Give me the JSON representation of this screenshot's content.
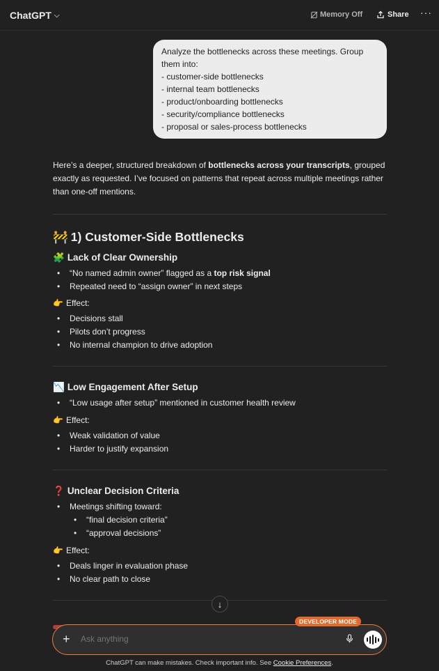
{
  "header": {
    "model_label": "ChatGPT",
    "memory_label": "Memory Off",
    "share_label": "Share",
    "more_label": "···"
  },
  "user_message": {
    "lines": [
      "Analyze the bottlenecks across these meetings. Group",
      "them into:",
      "- customer-side bottlenecks",
      "- internal team bottlenecks",
      "- product/onboarding bottlenecks",
      "- security/compliance bottlenecks",
      "- proposal or sales-process bottlenecks"
    ]
  },
  "assistant": {
    "intro_pre": "Here’s a deeper, structured breakdown of ",
    "intro_bold": "bottlenecks across your transcripts",
    "intro_post": ", grouped exactly as requested. I’ve focused on patterns that repeat across multiple meetings rather than one-off mentions.",
    "section1_icon": "🚧",
    "section1_title": "1) Customer-Side Bottlenecks",
    "effect_icon": "👉",
    "effect_label": "Effect:",
    "sub1": {
      "icon": "🧩",
      "title": "Lack of Clear Ownership",
      "bullet1_pre": "“No named admin owner” flagged as a ",
      "bullet1_bold": "top risk signal",
      "bullet2": "Repeated need to “assign owner” in next steps",
      "effects": [
        "Decisions stall",
        "Pilots don’t progress",
        "No internal champion to drive adoption"
      ]
    },
    "sub2": {
      "icon": "📉",
      "title": "Low Engagement After Setup",
      "bullet1": "“Low usage after setup” mentioned in customer health review",
      "effects": [
        "Weak validation of value",
        "Harder to justify expansion"
      ]
    },
    "sub3": {
      "icon": "❓",
      "title": "Unclear Decision Criteria",
      "bullet1": "Meetings shifting toward:",
      "subbullets": [
        "“final decision criteria”",
        "“approval decisions”"
      ],
      "effects": [
        "Deals linger in evaluation phase",
        "No clear path to close"
      ]
    }
  },
  "composer": {
    "dev_badge": "DEVELOPER MODE",
    "placeholder": "Ask anything"
  },
  "footer": {
    "disclaimer_pre": "ChatGPT can make mistakes. Check important info. See ",
    "disclaimer_link": "Cookie Preferences",
    "disclaimer_post": "."
  },
  "icons": [
    "chevron-down-icon",
    "memory-off-icon",
    "share-icon",
    "more-icon",
    "scroll-down-icon",
    "plus-icon",
    "mic-icon",
    "voice-mode-icon"
  ],
  "colors": {
    "background": "#212121",
    "user_bubble": "#ececec",
    "composer_border": "#f07b3f",
    "dev_badge": "#e26a2c"
  }
}
